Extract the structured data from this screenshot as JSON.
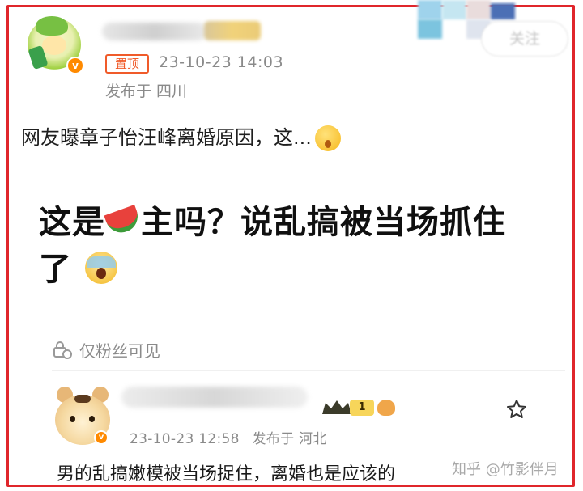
{
  "post": {
    "pin_label": "置顶",
    "time": "23-10-23 14:03",
    "location": "发布于 四川",
    "text": "网友曝章子怡汪峰离婚原因，这...",
    "image_line1_a": "这是",
    "image_line1_b": "主吗？说乱搞被当场抓住",
    "image_line2": "了",
    "visibility": "仅粉丝可见",
    "follow_label": "关注"
  },
  "comment": {
    "level": "1",
    "time": "23-10-23 12:58",
    "location": "发布于 河北",
    "text": "男的乱搞嫩模被当场捉住，离婚也是应该的"
  },
  "watermark": "知乎 @竹影伴月",
  "colors": {
    "frame": "#e0262b",
    "pin": "#f05b2a",
    "meta_gray": "#8a8a8a",
    "verify": "#ff8a00"
  },
  "icons": [
    "verified-badge-icon",
    "emoji-surprised-icon",
    "watermelon-icon",
    "emoji-scream-icon",
    "lock-icon",
    "crown-icon",
    "bird-icon",
    "star-icon"
  ]
}
